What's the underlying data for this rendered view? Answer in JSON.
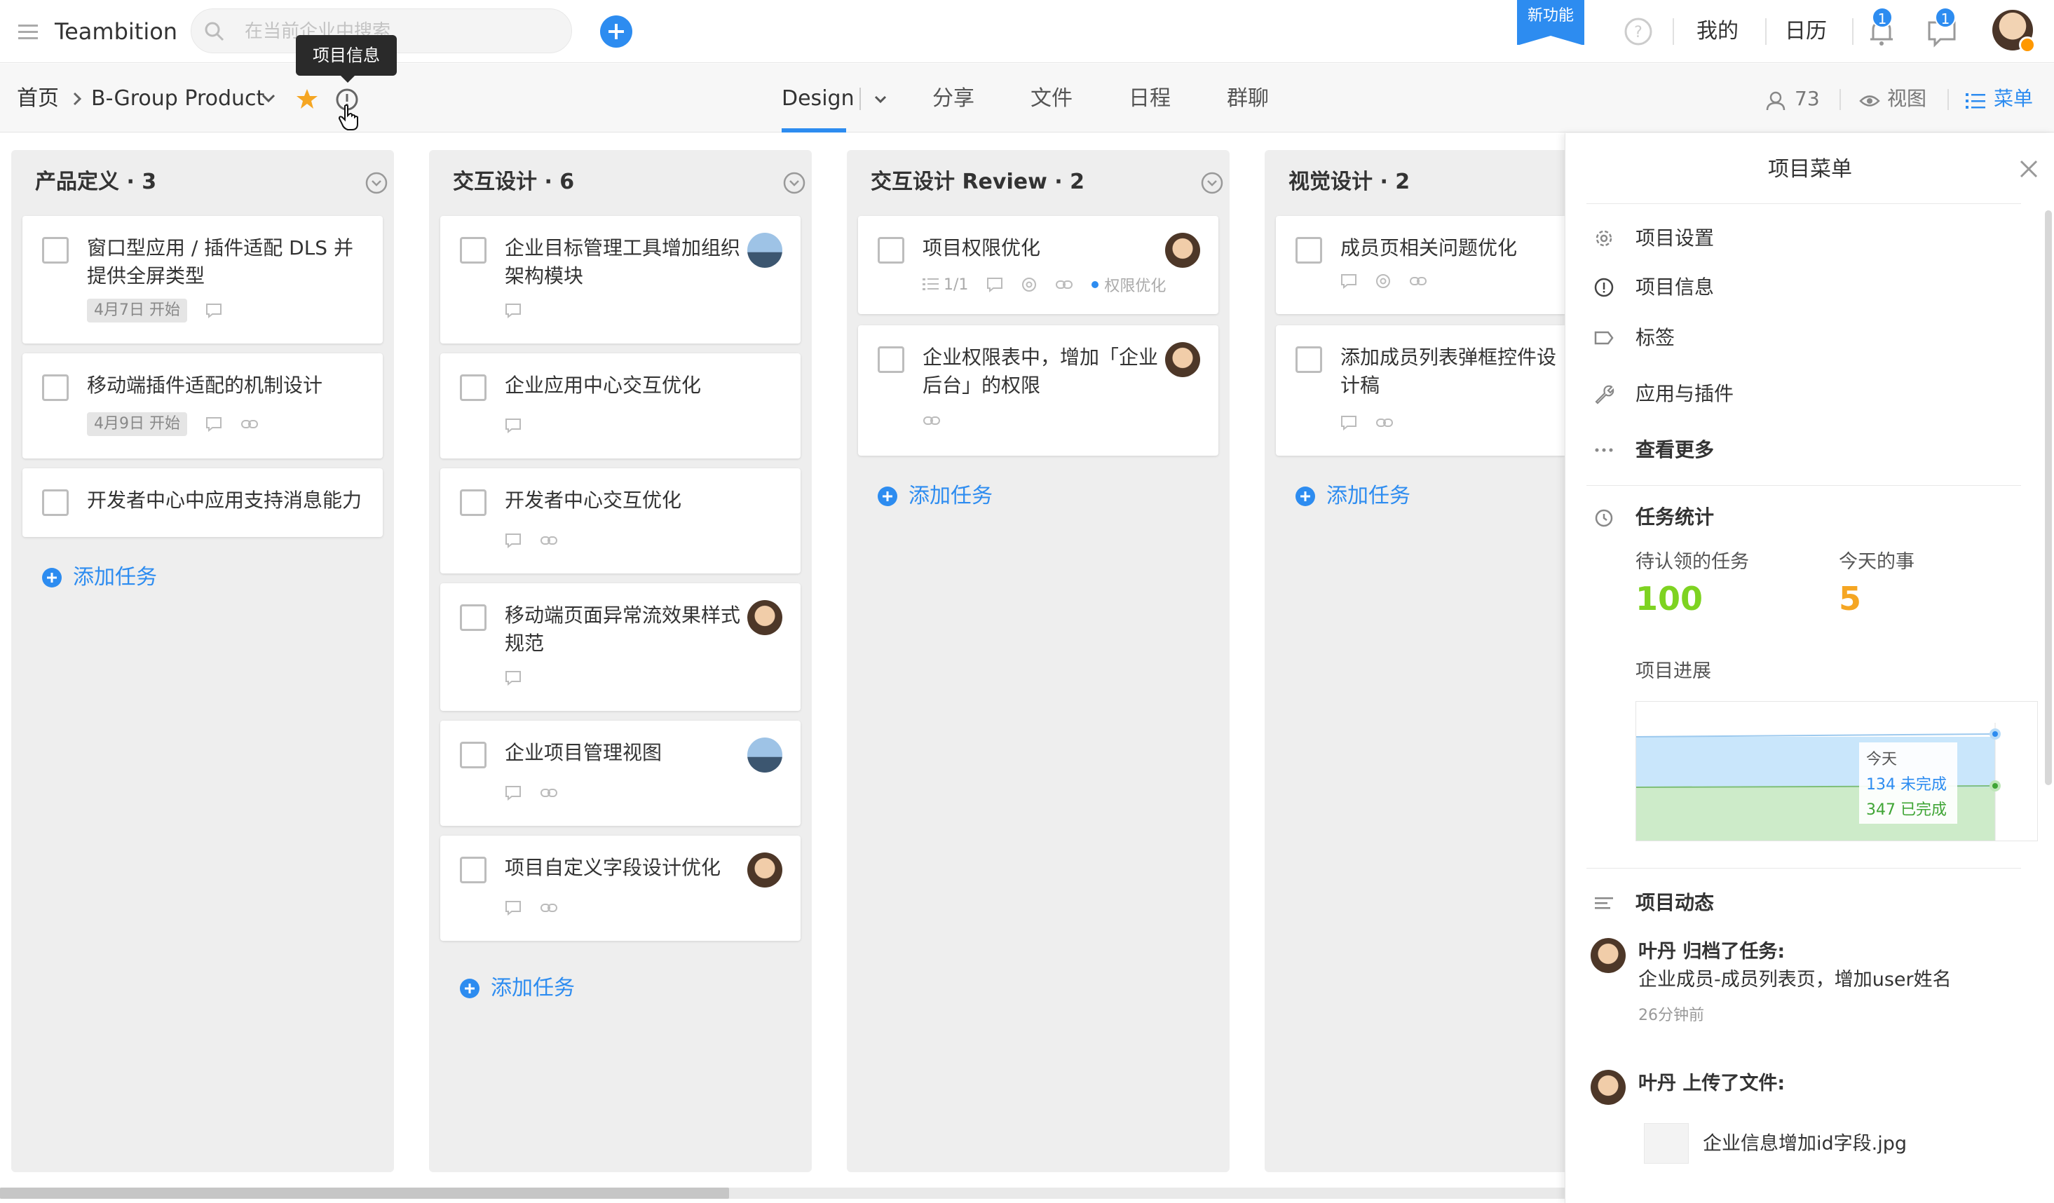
{
  "app": {
    "name": "Teambition"
  },
  "search": {
    "placeholder": "在当前企业中搜索"
  },
  "topbar": {
    "new_feature": "新功能",
    "mine": "我的",
    "calendar": "日历",
    "notif_count": "1",
    "msg_count": "1"
  },
  "breadcrumb": {
    "home": "首页",
    "project": "B-Group Product"
  },
  "tooltip": "项目信息",
  "tabs": [
    {
      "label": "Design"
    },
    {
      "label": "分享"
    },
    {
      "label": "文件"
    },
    {
      "label": "日程"
    },
    {
      "label": "群聊"
    }
  ],
  "subbar_right": {
    "members": "73",
    "view": "视图",
    "menu": "菜单"
  },
  "columns": [
    {
      "title": "产品定义 · 3",
      "add": "添加任务",
      "cards": [
        {
          "title": "窗口型应用 / 插件适配 DLS 并提供全屏类型",
          "date": "4月7日 开始"
        },
        {
          "title": "移动端插件适配的机制设计",
          "date": "4月9日 开始"
        },
        {
          "title": "开发者中心中应用支持消息能力"
        }
      ]
    },
    {
      "title": "交互设计 · 6",
      "add": "添加任务",
      "cards": [
        {
          "title": "企业目标管理工具增加组织架构模块"
        },
        {
          "title": "企业应用中心交互优化"
        },
        {
          "title": "开发者中心交互优化"
        },
        {
          "title": "移动端页面异常流效果样式规范"
        },
        {
          "title": "企业项目管理视图"
        },
        {
          "title": "项目自定义字段设计优化"
        }
      ]
    },
    {
      "title": "交互设计 Review · 2",
      "add": "添加任务",
      "cards": [
        {
          "title": "项目权限优化",
          "subtasks": "1/1",
          "tag": "权限优化"
        },
        {
          "title": "企业权限表中，增加「企业后台」的权限"
        }
      ]
    },
    {
      "title": "视觉设计 · 2",
      "add": "添加任务",
      "cards": [
        {
          "title": "成员页相关问题优化"
        },
        {
          "title": "添加成员列表弹框控件设计稿"
        }
      ]
    }
  ],
  "panel": {
    "title": "项目菜单",
    "items": [
      {
        "label": "项目设置",
        "icon": "gear-icon"
      },
      {
        "label": "项目信息",
        "icon": "info-icon"
      },
      {
        "label": "标签",
        "icon": "tag-icon"
      },
      {
        "label": "应用与插件",
        "icon": "wrench-icon"
      },
      {
        "label": "查看更多",
        "icon": "more-icon"
      }
    ],
    "stats": {
      "title": "任务统计",
      "pending_label": "待认领的任务",
      "pending_value": "100",
      "today_label": "今天的事",
      "today_value": "5",
      "progress_label": "项目进展",
      "chart_today": "今天",
      "chart_incomplete": "134 未完成",
      "chart_done": "347 已完成"
    },
    "feed": {
      "title": "项目动态",
      "entries": [
        {
          "text": "叶丹 归档了任务:",
          "detail": "企业成员-成员列表页，增加user姓名",
          "time": "26分钟前"
        },
        {
          "text": "叶丹 上传了文件:",
          "file": "企业信息增加id字段.jpg"
        }
      ]
    }
  },
  "colors": {
    "accent": "#2d8cf0",
    "star": "#f5a623",
    "green": "#7ed321",
    "orange": "#f5a623"
  }
}
